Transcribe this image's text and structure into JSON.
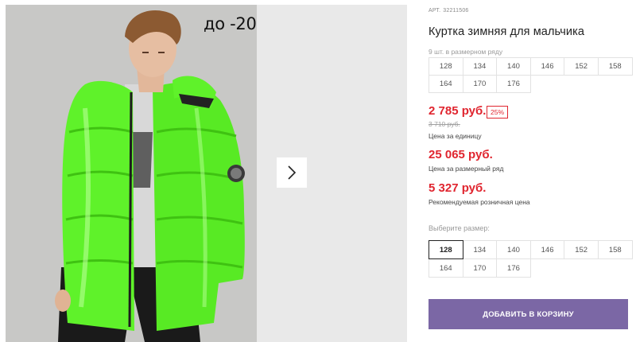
{
  "gallery": {
    "discount_badge": "до -20",
    "next_arrow_icon": "chevron-right-icon"
  },
  "product": {
    "sku_label": "АРТ.",
    "sku_value": "32211506",
    "title": "Куртка зимняя для мальчика",
    "range_caption": "9 шт. в размерном ряду",
    "range_sizes": [
      "128",
      "134",
      "140",
      "146",
      "152",
      "158",
      "164",
      "170",
      "176"
    ],
    "price": "2 785 руб.",
    "discount_percent": "25%",
    "old_price": "3 710 руб.",
    "unit_price_note": "Цена за единицу",
    "range_price": "25 065 руб.",
    "range_price_note": "Цена за размерный ряд",
    "retail_price": "5 327 руб.",
    "retail_price_note": "Рекомендуемая розничная цена",
    "choose_size_caption": "Выберите размер:",
    "choose_sizes": [
      "128",
      "134",
      "140",
      "146",
      "152",
      "158",
      "164",
      "170",
      "176"
    ],
    "selected_size": "128",
    "add_to_cart_label": "ДОБАВИТЬ В КОРЗИНУ"
  },
  "colors": {
    "price_red": "#e0252f",
    "button_purple": "#7b67a5",
    "jacket_green": "#5ff22a"
  }
}
